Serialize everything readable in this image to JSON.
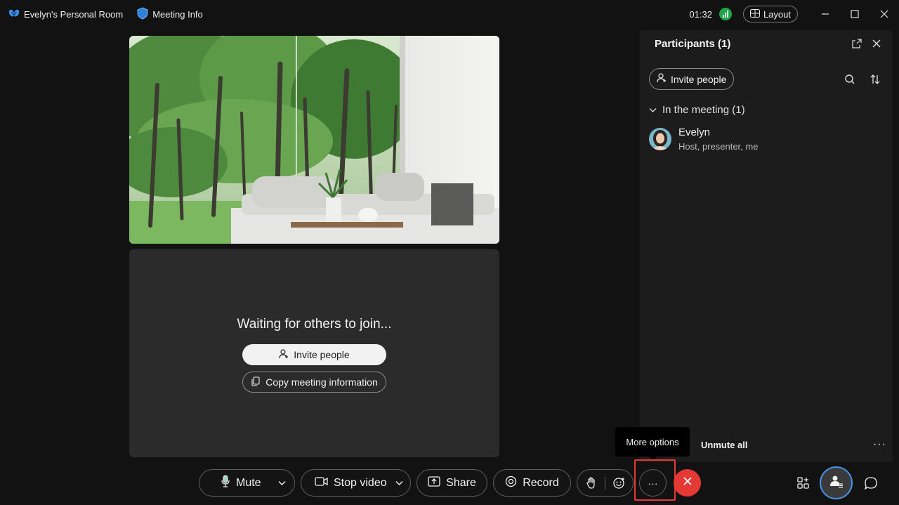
{
  "titlebar": {
    "room_name": "Evelyn's Personal Room",
    "meeting_info": "Meeting Info",
    "clock": "01:32",
    "layout_label": "Layout"
  },
  "stage": {
    "waiting_text": "Waiting for others to join...",
    "invite_label": "Invite people",
    "copy_label": "Copy meeting information"
  },
  "participants_panel": {
    "title": "Participants (1)",
    "invite_label": "Invite people",
    "section_label": "In the meeting (1)",
    "participants": [
      {
        "name": "Evelyn",
        "role": "Host, presenter, me"
      }
    ],
    "unmute_all": "Unmute all",
    "more_glyph": "···"
  },
  "tooltip": {
    "text": "More options"
  },
  "controls": {
    "mute_label": "Mute",
    "stop_video_label": "Stop video",
    "share_label": "Share",
    "record_label": "Record",
    "more_glyph": "···"
  },
  "colors": {
    "end_call": "#e53935",
    "signal": "#1ea548",
    "highlight": "#e53935",
    "self_view_ring": "#4a90e2"
  },
  "icons": [
    "webex-logo-icon",
    "shield-icon",
    "signal-icon",
    "layout-icon",
    "minimize-icon",
    "maximize-icon",
    "close-icon",
    "person-add-icon",
    "copy-icon",
    "popout-icon",
    "search-icon",
    "sort-icon",
    "chevron-down-icon",
    "microphone-icon",
    "camera-icon",
    "share-icon",
    "record-icon",
    "raise-hand-icon",
    "emoji-icon",
    "more-icon",
    "end-call-icon",
    "apps-icon",
    "participants-icon",
    "chat-icon"
  ]
}
